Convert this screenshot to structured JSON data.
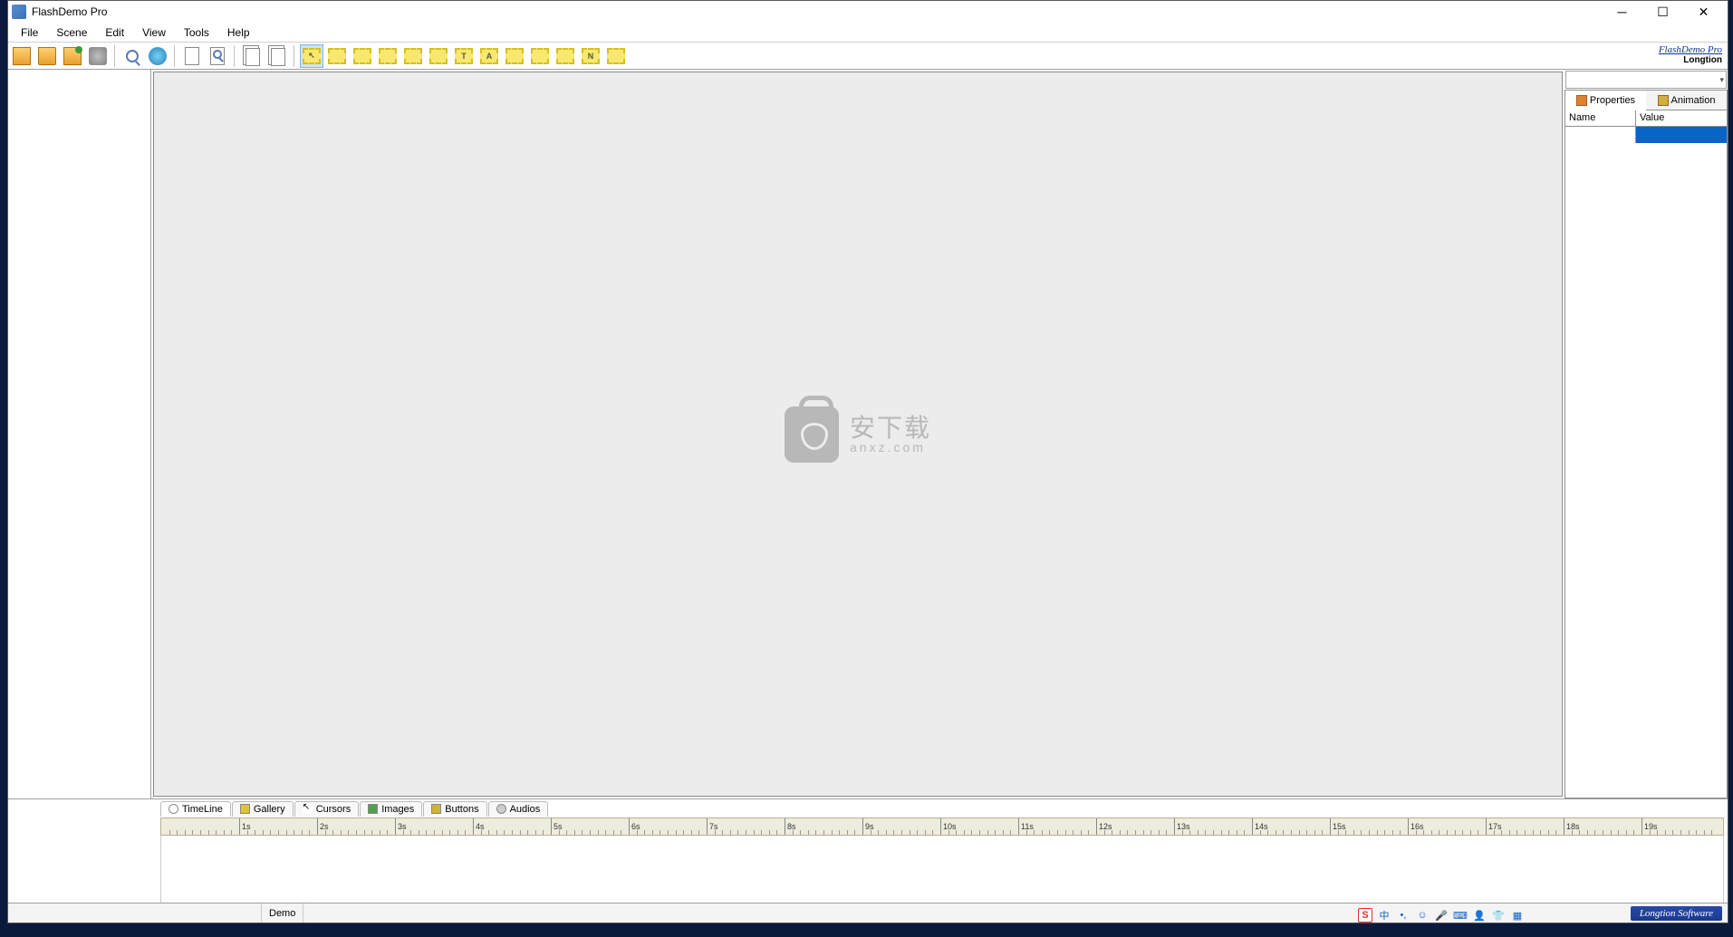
{
  "window": {
    "title": "FlashDemo Pro"
  },
  "menu": {
    "items": [
      "File",
      "Scene",
      "Edit",
      "View",
      "Tools",
      "Help"
    ]
  },
  "brand": {
    "title": "FlashDemo Pro",
    "subtitle": "Longtion"
  },
  "toolbar_frame_letters": [
    "",
    "",
    "",
    "",
    "",
    "",
    "T",
    "A",
    "",
    "",
    "",
    "N",
    ""
  ],
  "right_panel": {
    "tabs": {
      "properties": "Properties",
      "animation": "Animation"
    },
    "header": {
      "name": "Name",
      "value": "Value"
    }
  },
  "bottom_tabs": {
    "timeline": "TimeLine",
    "gallery": "Gallery",
    "cursors": "Cursors",
    "images": "Images",
    "buttons": "Buttons",
    "audios": "Audios"
  },
  "timeline": {
    "seconds": [
      "1s",
      "2s",
      "3s",
      "4s",
      "5s",
      "6s",
      "7s",
      "8s",
      "9s",
      "10s",
      "11s",
      "12s",
      "13s",
      "14s",
      "15s",
      "16s",
      "17s",
      "18s",
      "19s"
    ]
  },
  "status": {
    "demo": "Demo",
    "longtion": "Longtion Software"
  },
  "watermark": {
    "main": "安下载",
    "sub": "anxz.com"
  },
  "tray": {
    "ime": "中"
  }
}
